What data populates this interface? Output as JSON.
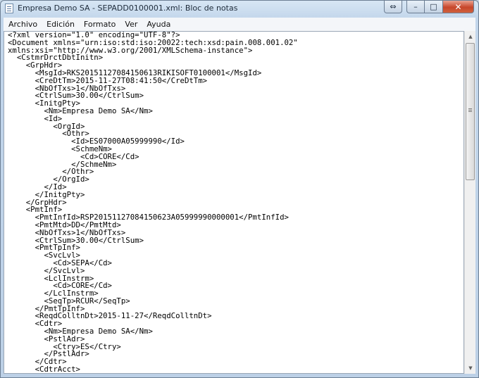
{
  "window": {
    "title": "Empresa Demo SA - SEPADD0100001.xml: Bloc de notas",
    "buttons": {
      "extra": "⇔",
      "minimize": "–",
      "maximize": "□",
      "close": "✕"
    }
  },
  "menu": {
    "items": [
      {
        "label": "Archivo",
        "name": "menu-archivo"
      },
      {
        "label": "Edición",
        "name": "menu-edicion"
      },
      {
        "label": "Formato",
        "name": "menu-formato"
      },
      {
        "label": "Ver",
        "name": "menu-ver"
      },
      {
        "label": "Ayuda",
        "name": "menu-ayuda"
      }
    ]
  },
  "scrollbar": {
    "up_arrow": "▲",
    "down_arrow": "▼",
    "position_fraction": 0.0
  },
  "content": {
    "lines": [
      "<?xml version=\"1.0\" encoding=\"UTF-8\"?>",
      "<Document xmlns=\"urn:iso:std:iso:20022:tech:xsd:pain.008.001.02\"",
      "xmlns:xsi=\"http://www.w3.org/2001/XMLSchema-instance\">",
      "  <CstmrDrctDbtInitn>",
      "    <GrpHdr>",
      "      <MsgId>RKS20151127084150613RIKISOFT0100001</MsgId>",
      "      <CreDtTm>2015-11-27T08:41:50</CreDtTm>",
      "      <NbOfTxs>1</NbOfTxs>",
      "      <CtrlSum>30.00</CtrlSum>",
      "      <InitgPty>",
      "        <Nm>Empresa Demo SA</Nm>",
      "        <Id>",
      "          <OrgId>",
      "            <Othr>",
      "              <Id>ES07000A05999990</Id>",
      "              <SchmeNm>",
      "                <Cd>CORE</Cd>",
      "              </SchmeNm>",
      "            </Othr>",
      "          </OrgId>",
      "        </Id>",
      "      </InitgPty>",
      "    </GrpHdr>",
      "    <PmtInf>",
      "      <PmtInfId>RSP20151127084150623A05999990000001</PmtInfId>",
      "      <PmtMtd>DD</PmtMtd>",
      "      <NbOfTxs>1</NbOfTxs>",
      "      <CtrlSum>30.00</CtrlSum>",
      "      <PmtTpInf>",
      "        <SvcLvl>",
      "          <Cd>SEPA</Cd>",
      "        </SvcLvl>",
      "        <LclInstrm>",
      "          <Cd>CORE</Cd>",
      "        </LclInstrm>",
      "        <SeqTp>RCUR</SeqTp>",
      "      </PmtTpInf>",
      "      <ReqdColltnDt>2015-11-27</ReqdColltnDt>",
      "      <Cdtr>",
      "        <Nm>Empresa Demo SA</Nm>",
      "        <PstlAdr>",
      "          <Ctry>ES</Ctry>",
      "        </PstlAdr>",
      "      </Cdtr>",
      "      <CdtrAcct>"
    ]
  }
}
